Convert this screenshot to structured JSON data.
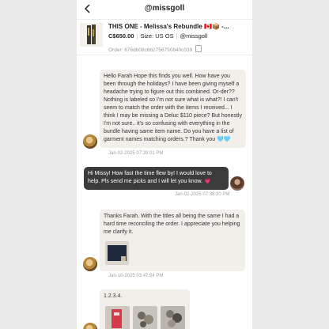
{
  "header": {
    "title": "@missgoll"
  },
  "order": {
    "title": "THIS ONE - Melissa's Rebundle 🇨🇦📦 -...",
    "price": "C$650.00",
    "size_label": "Size:",
    "size": "US OS",
    "seller": "@missgoll",
    "order_id": "Order: 676db08c6b2756790840c039"
  },
  "messages": [
    {
      "from": "them",
      "text": "Hello Farah Hope this finds you well. How have you been through the holidays? I have been giving myself a headache trying to figure out this combined. Or-der?? Nothing is labeled so I'm not sure what is what?! I can't seem to match the order with the items I received... I think I may be missing a Deluc $110 piece? But honestly I'm not sure.. it's so confusing with everything in the bundle having same item name. Do you have a list of garment names matching orders.? Thank you 🩵🩵",
      "time": "Jan-02-2025 07:28:01 PM"
    },
    {
      "from": "me",
      "text": "Hi Missy! How fast the time flew by! I would love to help. Pls send me picks and I will let you know. 💗",
      "time": "Jan-02-2025 07:38:10 PM"
    },
    {
      "from": "them",
      "text": "Thanks Farah. With the titles all being the same I had a hard time reconciling the order. I appreciate you helping me clarify it.",
      "time": "Jan-10-2025 03:47:54 PM"
    },
    {
      "from": "them",
      "text": "1.2.3.4."
    }
  ]
}
